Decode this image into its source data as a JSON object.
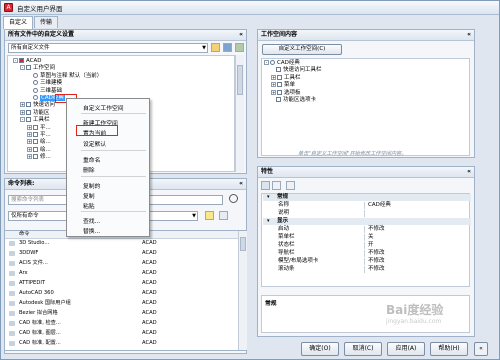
{
  "window": {
    "title": "自定义用户界面"
  },
  "tabs": [
    "自定义",
    "传输"
  ],
  "left": {
    "title": "所有文件中的自定义设置",
    "dropdown": "所有自定义文件",
    "tree": [
      "ACAD",
      "工作空间",
      "草图与注释 默认（当前）",
      "三维建模",
      "三维基础",
      "CAD经典",
      "快速访问",
      "功能区",
      "工具栏",
      "平...",
      "平...",
      "绘...",
      "绘...",
      "修..."
    ]
  },
  "context_menu": {
    "items": [
      "自定义工作空间",
      "新建工作空间",
      "置为当前",
      "设定默认",
      "重命名",
      "删除",
      "复制的",
      "复制",
      "粘贴",
      "查找...",
      "替换..."
    ]
  },
  "commands": {
    "title": "命令列表:",
    "search_placeholder": "搜索命令列表",
    "filter": "仅所有命令",
    "col_command": "命令",
    "col_source": "源",
    "rows": [
      {
        "name": "3D Studio...",
        "src": "ACAD"
      },
      {
        "name": "3DDWF",
        "src": "ACAD"
      },
      {
        "name": "ACIS 文件...",
        "src": "ACAD"
      },
      {
        "name": "Arx",
        "src": "ACAD"
      },
      {
        "name": "ATTIPEDIT",
        "src": "ACAD"
      },
      {
        "name": "AutoCAD 360",
        "src": "ACAD"
      },
      {
        "name": "Autodesk 国际用户组",
        "src": "ACAD"
      },
      {
        "name": "Bezier 拟合网格",
        "src": "ACAD"
      },
      {
        "name": "CAD 标准, 检查...",
        "src": "ACAD"
      },
      {
        "name": "CAD 标准, 图层...",
        "src": "ACAD"
      },
      {
        "name": "CAD 标准, 配置...",
        "src": "ACAD"
      }
    ]
  },
  "workspace": {
    "title": "工作空间内容",
    "button": "自定义工作空间(C)",
    "tree": [
      "CAD经典",
      "快速访问工具栏",
      "工具栏",
      "菜单",
      "选项板",
      "功能区选项卡"
    ],
    "hint": "单击\"自定义工作空间\"开始修改工作空间内容。"
  },
  "properties": {
    "title": "特性",
    "categories": [
      {
        "name": "常规",
        "rows": [
          {
            "k": "名称",
            "v": "CAD经典"
          },
          {
            "k": "说明",
            "v": ""
          }
        ]
      },
      {
        "name": "显示",
        "rows": [
          {
            "k": "启动",
            "v": "不修改"
          },
          {
            "k": "菜单栏",
            "v": "关"
          },
          {
            "k": "状态栏",
            "v": "开"
          },
          {
            "k": "导航栏",
            "v": "不修改"
          },
          {
            "k": "模型/布局选项卡",
            "v": "不修改"
          },
          {
            "k": "滚动条",
            "v": "不修改"
          }
        ]
      }
    ],
    "footer": "常规"
  },
  "buttons": [
    "确定(O)",
    "取消(C)",
    "应用(A)",
    "帮助(H)"
  ],
  "watermark": "Bai度经验",
  "watermark_sub": "jingyan.baidu.com",
  "colors": {
    "accent": "#3c7fb1",
    "highlight": "#e2231a",
    "selected": "#3399ff"
  }
}
